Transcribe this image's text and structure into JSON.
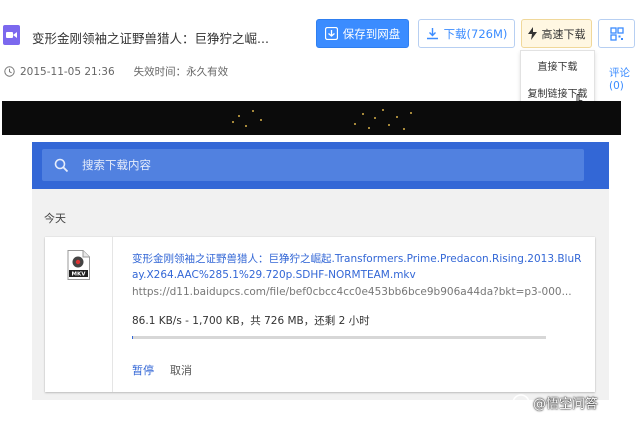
{
  "share": {
    "file_title": "变形金刚领袖之证野兽猎人：巨狰狞之崛...",
    "save_button": "保存到网盘",
    "download_button": "下载(726M)",
    "fast_download_button": "高速下载",
    "date": "2015-11-05 21:36",
    "expire": "失效时间：永久有效",
    "comment_link": "评论(0)",
    "dropdown": {
      "item_direct": "直接下载",
      "item_copy": "复制链接下载"
    }
  },
  "downloads": {
    "search_placeholder": "搜索下载内容",
    "section_today": "今天",
    "item": {
      "file_icon_label": "MKV",
      "name": "变形金刚领袖之证野兽猎人：巨狰狞之崛起.Transformers.Prime.Predacon.Rising.2013.BluRay.X264.AAC%285.1%29.720p.SDHF-NORMTEAM.mkv",
      "url": "https://d11.baidupcs.com/file/bef0cbcc4cc0e453bb6bce9b906a44da?bkt=p3-000...",
      "status": "86.1 KB/s - 1,700 KB，共 726 MB，还剩 2 小时",
      "progress_percent": 0.2,
      "pause_label": "暂停",
      "cancel_label": "取消"
    }
  },
  "watermark": {
    "text": "@悟空问答"
  },
  "colors": {
    "baidu_blue": "#3b8cff",
    "chrome_blue": "#3367d6",
    "fast_download_bg": "#fff7e2"
  }
}
